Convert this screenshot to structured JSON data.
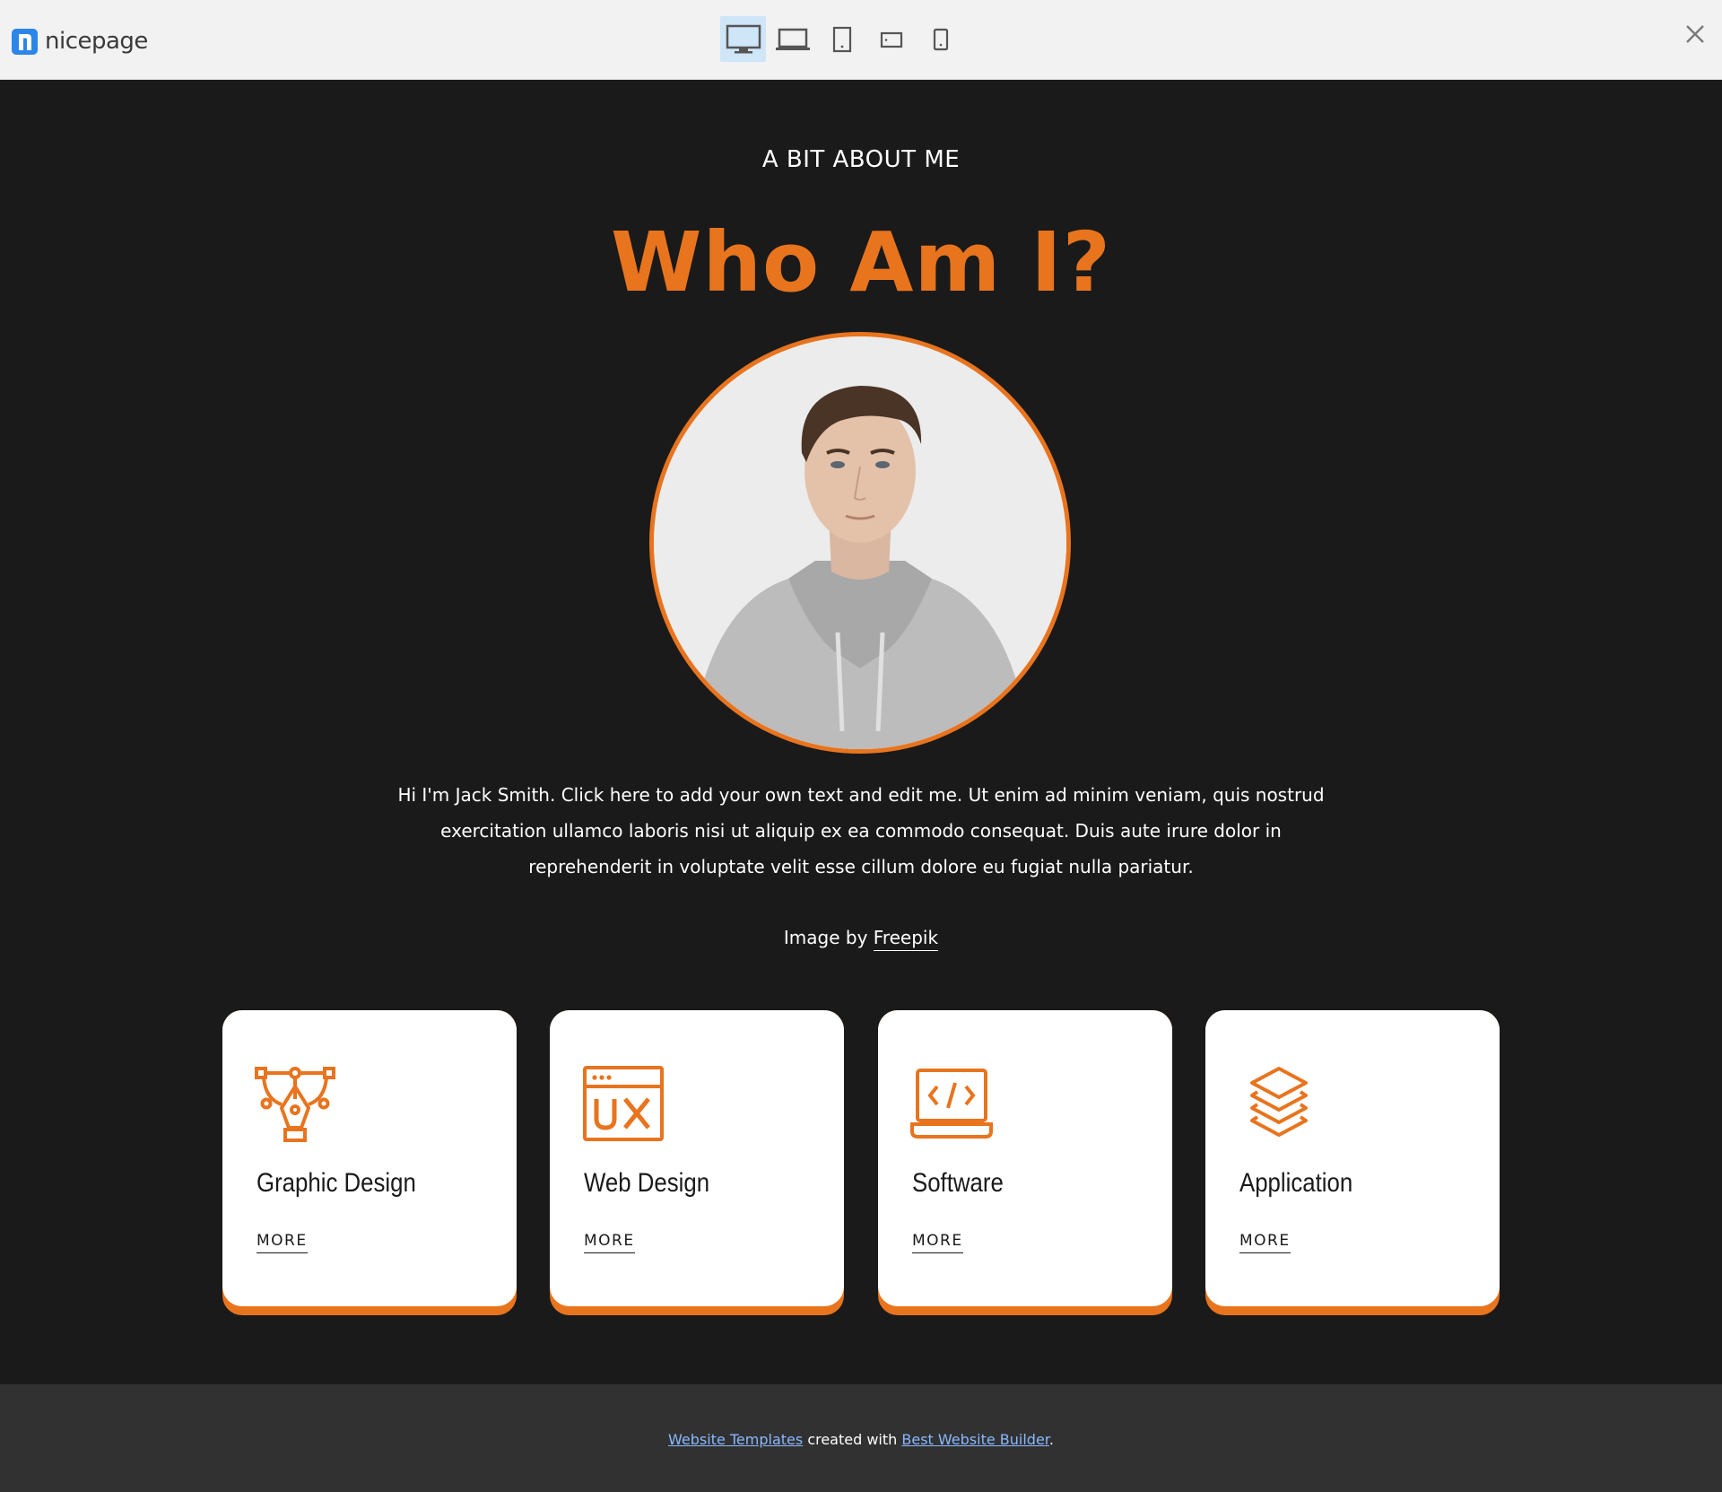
{
  "toolbar": {
    "logo_text": "nicepage",
    "devices": [
      "desktop",
      "laptop",
      "tablet",
      "tablet-landscape",
      "phone"
    ],
    "active_device": "desktop"
  },
  "section": {
    "eyebrow": "A BIT ABOUT ME",
    "headline": "Who Am I?",
    "bio": "Hi I'm Jack Smith. Click here to add your own text and edit me. Ut enim ad minim veniam, quis nostrud exercitation ullamco laboris nisi ut aliquip ex ea commodo consequat. Duis aute irure dolor in reprehenderit in voluptate velit esse cillum dolore eu fugiat nulla pariatur.",
    "credit_prefix": "Image by",
    "credit_link": "Freepik"
  },
  "cards": [
    {
      "title": "Graphic Design",
      "more": "MORE",
      "icon": "pen-tool-icon"
    },
    {
      "title": "Web Design",
      "more": "MORE",
      "icon": "ux-window-icon"
    },
    {
      "title": "Software",
      "more": "MORE",
      "icon": "laptop-code-icon"
    },
    {
      "title": "Application",
      "more": "MORE",
      "icon": "layers-icon"
    }
  ],
  "footer": {
    "link1": "Website Templates",
    "middle": "created with",
    "link2": "Best Website Builder",
    "end": "."
  },
  "colors": {
    "accent": "#e8741e",
    "background": "#1a1a1a",
    "footer_bg": "#313131",
    "footer_link": "#8ab8ff"
  }
}
